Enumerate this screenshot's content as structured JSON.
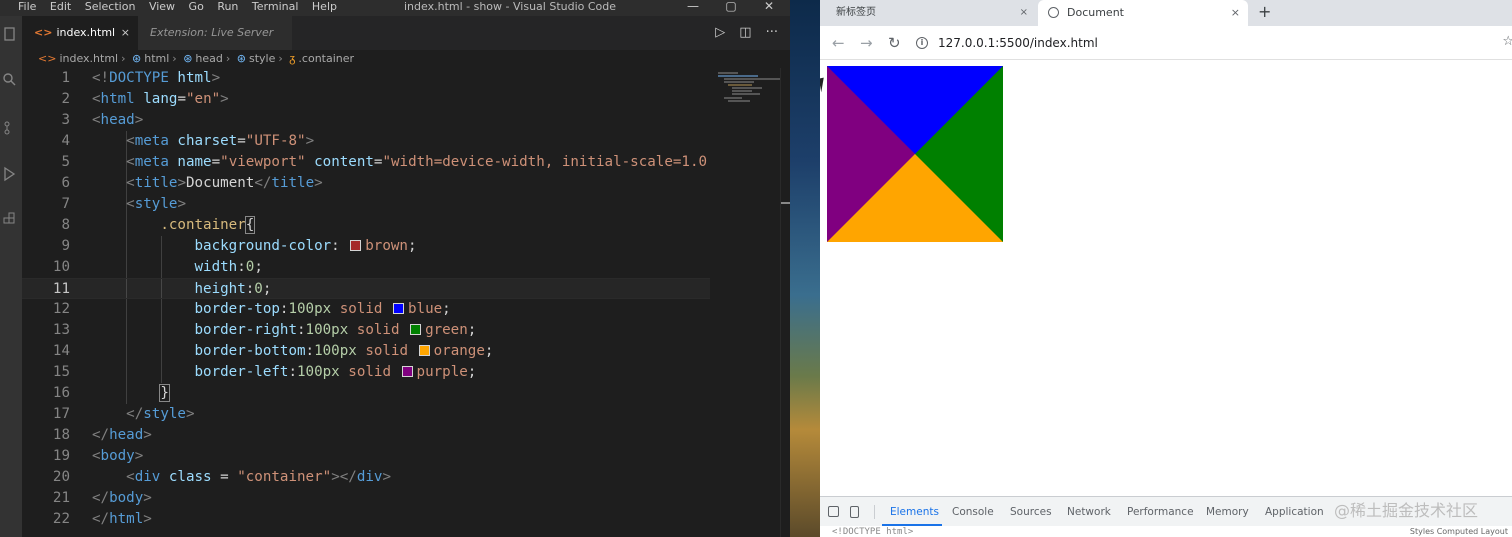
{
  "vscode": {
    "menu": [
      "File",
      "Edit",
      "Selection",
      "View",
      "Go",
      "Run",
      "Terminal",
      "Help"
    ],
    "window_title": "index.html - show - Visual Studio Code",
    "tabs": [
      {
        "label": "index.html",
        "icon": "html-file-icon"
      },
      {
        "label": "Extension: Live Server",
        "icon": ""
      }
    ],
    "tab_close_glyph": "×",
    "breadcrumb": [
      "index.html",
      "html",
      "head",
      "style",
      ".container"
    ],
    "current_line": 11,
    "swatch_colors": {
      "brown": "#a52a2a",
      "blue": "#0000ff",
      "green": "#008000",
      "orange": "#ffa500",
      "purple": "#800080"
    },
    "lines": [
      {
        "n": "1"
      },
      {
        "n": "2"
      },
      {
        "n": "3"
      },
      {
        "n": "4"
      },
      {
        "n": "5"
      },
      {
        "n": "6"
      },
      {
        "n": "7"
      },
      {
        "n": "8"
      },
      {
        "n": "9"
      },
      {
        "n": "10"
      },
      {
        "n": "11"
      },
      {
        "n": "12"
      },
      {
        "n": "13"
      },
      {
        "n": "14"
      },
      {
        "n": "15"
      },
      {
        "n": "16"
      },
      {
        "n": "17"
      },
      {
        "n": "18"
      },
      {
        "n": "19"
      },
      {
        "n": "20"
      },
      {
        "n": "21"
      },
      {
        "n": "22"
      }
    ],
    "code": {
      "l1_open": "<!",
      "l1_doctype": "DOCTYPE",
      "l1_html": " html",
      "l1_close": ">",
      "l2_open": "<",
      "l2_tag": "html",
      "l2_attr": " lang",
      "l2_eq": "=",
      "l2_val": "\"en\"",
      "l2_close": ">",
      "l3_open": "<",
      "l3_tag": "head",
      "l3_close": ">",
      "l4_open": "<",
      "l4_tag": "meta",
      "l4_attr": " charset",
      "l4_eq": "=",
      "l4_val": "\"UTF-8\"",
      "l4_close": ">",
      "l5_open": "<",
      "l5_tag": "meta",
      "l5_attr1": " name",
      "l5_eq1": "=",
      "l5_val1": "\"viewport\"",
      "l5_attr2": " content",
      "l5_eq2": "=",
      "l5_val2": "\"width=device-width, initial-scale=1.0",
      "l6_open": "<",
      "l6_tag": "title",
      "l6_close": ">",
      "l6_text": "Document",
      "l6_open2": "</",
      "l6_tag2": "title",
      "l6_close2": ">",
      "l7_open": "<",
      "l7_tag": "style",
      "l7_close": ">",
      "l8_sel": ".container",
      "l8_brace": "{",
      "l9_prop": "background-color",
      "l9_colon": ": ",
      "l9_val": "brown",
      "l9_semi": ";",
      "l10_prop": "width",
      "l10_colon": ":",
      "l10_num": "0",
      "l10_semi": ";",
      "l11_prop": "height",
      "l11_colon": ":",
      "l11_num": "0",
      "l11_semi": ";",
      "l12_prop": "border-top",
      "l12_colon": ":",
      "l12_num": "100px",
      "l12_kw": " solid ",
      "l12_val": "blue",
      "l12_semi": ";",
      "l13_prop": "border-right",
      "l13_colon": ":",
      "l13_num": "100px",
      "l13_kw": " solid ",
      "l13_val": "green",
      "l13_semi": ";",
      "l14_prop": "border-bottom",
      "l14_colon": ":",
      "l14_num": "100px",
      "l14_kw": " solid ",
      "l14_val": "orange",
      "l14_semi": ";",
      "l15_prop": "border-left",
      "l15_colon": ":",
      "l15_num": "100px",
      "l15_kw": " solid ",
      "l15_val": "purple",
      "l15_semi": ";",
      "l16_brace": "}",
      "l17_open": "</",
      "l17_tag": "style",
      "l17_close": ">",
      "l18_open": "</",
      "l18_tag": "head",
      "l18_close": ">",
      "l19_open": "<",
      "l19_tag": "body",
      "l19_close": ">",
      "l20_open": "<",
      "l20_tag": "div",
      "l20_attr": " class",
      "l20_eq": " = ",
      "l20_val": "\"container\"",
      "l20_close": "></",
      "l20_tag2": "div",
      "l20_close2": ">",
      "l21_open": "</",
      "l21_tag": "body",
      "l21_close": ">",
      "l22_open": "</",
      "l22_tag": "html",
      "l22_close": ">"
    }
  },
  "chrome": {
    "tabs": [
      {
        "label": "新标签页"
      },
      {
        "label": "Document"
      }
    ],
    "close_glyph": "×",
    "new_tab_glyph": "+",
    "url": "127.0.0.1:5500/index.html",
    "triangle_colors": {
      "top": "#0000ff",
      "right": "#008000",
      "bottom": "#ffa500",
      "left": "#800080"
    },
    "devtools": {
      "tabs": [
        "Elements",
        "Console",
        "Sources",
        "Network",
        "Performance",
        "Memory",
        "Application"
      ],
      "active_tab": "Elements",
      "body_text": "<!DOCTYPE html>",
      "sub_tabs": "Styles   Computed   Layout"
    }
  },
  "watermark": "@稀土掘金技术社区"
}
